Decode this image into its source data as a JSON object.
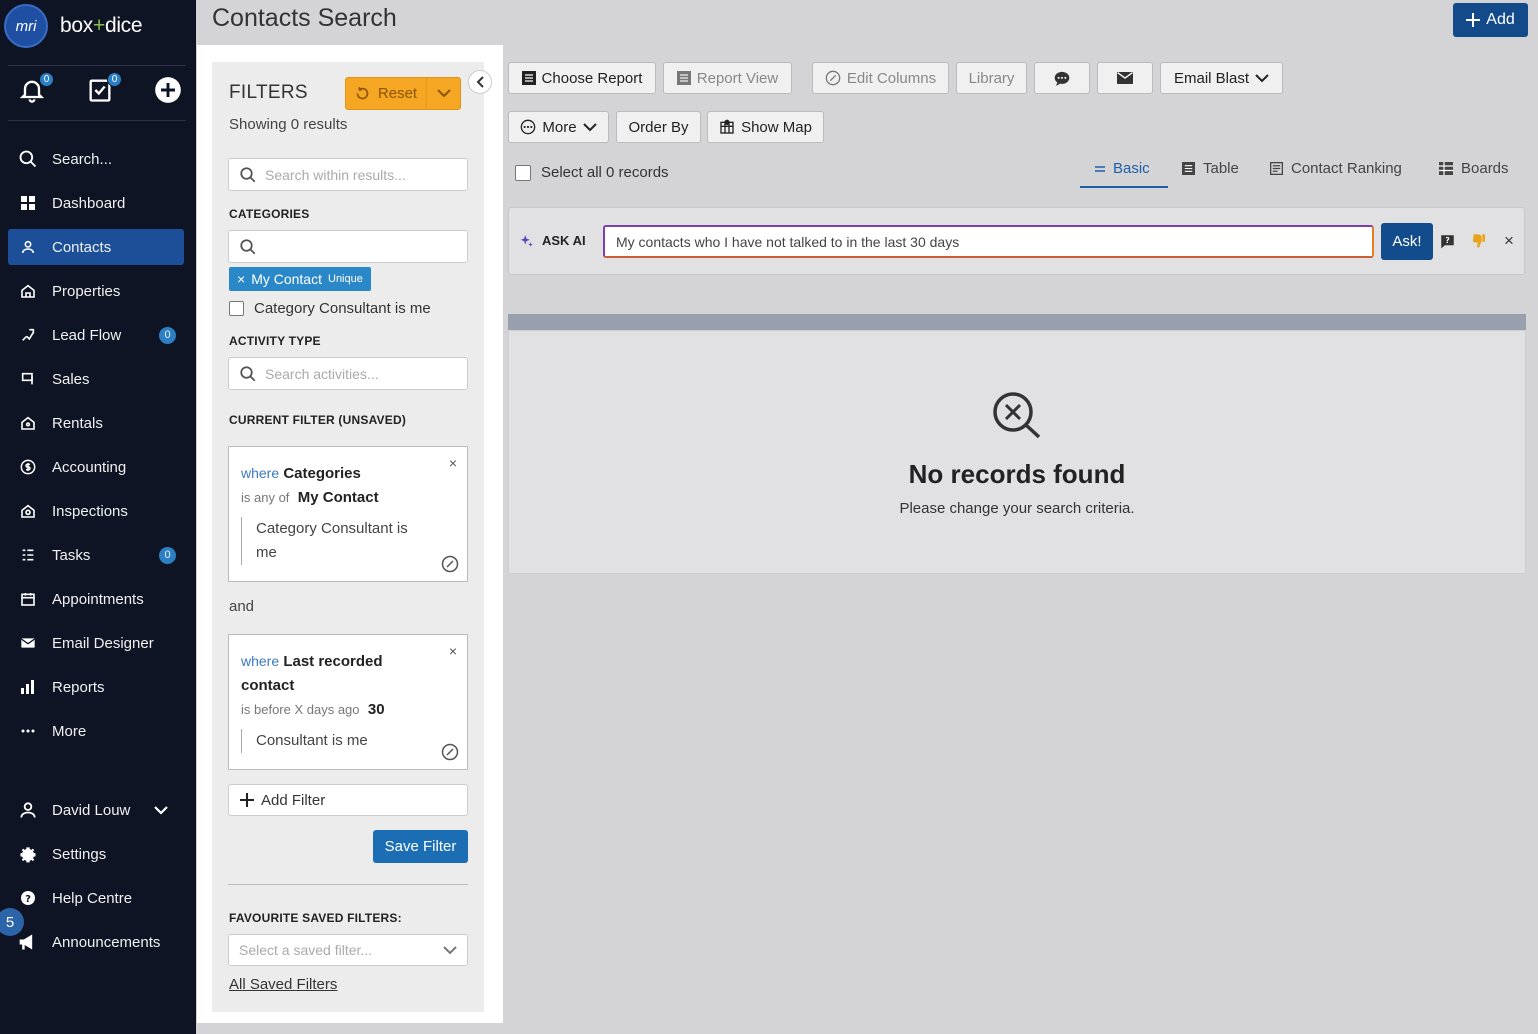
{
  "app": {
    "logo_mark": "mri",
    "logo_text_left": "box",
    "logo_text_plus": "+",
    "logo_text_right": "dice"
  },
  "top_icons": {
    "notifications_count": "0",
    "tasks_count": "0"
  },
  "nav": {
    "items": [
      {
        "label": "Search...",
        "icon": "search-icon"
      },
      {
        "label": "Dashboard",
        "icon": "dashboard-icon"
      },
      {
        "label": "Contacts",
        "icon": "contact-icon"
      },
      {
        "label": "Properties",
        "icon": "home-icon"
      },
      {
        "label": "Lead Flow",
        "icon": "lead-icon",
        "badge": "0"
      },
      {
        "label": "Sales",
        "icon": "sales-icon"
      },
      {
        "label": "Rentals",
        "icon": "rentals-icon"
      },
      {
        "label": "Accounting",
        "icon": "dollar-icon"
      },
      {
        "label": "Inspections",
        "icon": "inspection-icon"
      },
      {
        "label": "Tasks",
        "icon": "tasks-icon",
        "badge": "0"
      },
      {
        "label": "Appointments",
        "icon": "calendar-icon"
      },
      {
        "label": "Email Designer",
        "icon": "mail-icon"
      },
      {
        "label": "Reports",
        "icon": "chart-icon"
      },
      {
        "label": "More",
        "icon": "more-icon"
      }
    ],
    "user_name": "David Louw",
    "settings": "Settings",
    "help": "Help Centre",
    "announcements": "Announcements",
    "announcements_badge": "5"
  },
  "header": {
    "title": "Contacts Search",
    "add_label": "Add"
  },
  "filters": {
    "title": "FILTERS",
    "reset_label": "Reset",
    "showing": "Showing 0 results",
    "search_placeholder": "Search within results...",
    "categories_label": "CATEGORIES",
    "category_tag": "My Contact",
    "category_tag_suffix": "Unique",
    "category_consultant_label": "Category Consultant is me",
    "activity_type_label": "ACTIVITY TYPE",
    "activity_placeholder": "Search activities...",
    "current_filter_label": "CURRENT FILTER (UNSAVED)",
    "card1": {
      "where": "where",
      "field": "Categories",
      "op": "is any of",
      "value": "My Contact",
      "sub_line1": "Category Consultant is",
      "sub_line2": "me"
    },
    "and_text": "and",
    "card2": {
      "where": "where",
      "field_line1": "Last recorded",
      "field_line2": "contact",
      "op": "is before X days ago",
      "value": "30",
      "sub": "Consultant is me"
    },
    "add_filter": "Add Filter",
    "save_filter": "Save Filter",
    "favourite_label": "FAVOURITE SAVED FILTERS:",
    "saved_placeholder": "Select a saved filter...",
    "all_saved": "All Saved Filters"
  },
  "toolbar": {
    "choose_report": "Choose Report",
    "report_view": "Report View",
    "edit_columns": "Edit Columns",
    "library": "Library",
    "email_blast": "Email Blast",
    "more": "More",
    "order_by": "Order By",
    "show_map": "Show Map",
    "select_all": "Select all 0 records"
  },
  "view_tabs": {
    "basic": "Basic",
    "table": "Table",
    "ranking": "Contact Ranking",
    "boards": "Boards"
  },
  "ask_ai": {
    "label": "ASK AI",
    "query": "My contacts who I have not talked to in the last 30 days",
    "button": "Ask!"
  },
  "results": {
    "title": "No records found",
    "subtitle": "Please change your search criteria."
  },
  "colors": {
    "sidebar_bg": "#0f1424",
    "active_nav": "#1c4f97",
    "reset": "#f5a623",
    "primary": "#1c6eb4"
  }
}
